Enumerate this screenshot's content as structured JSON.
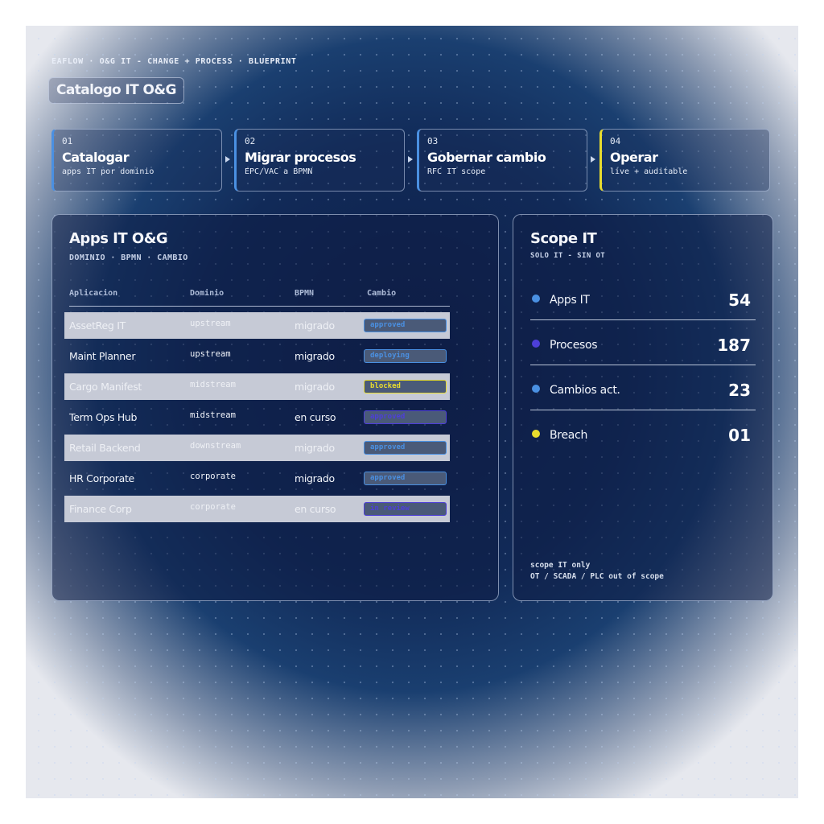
{
  "header": {
    "topline": "EAFLOW · O&G IT - CHANGE + PROCESS · BLUEPRINT",
    "title": "Catalogo IT O&G"
  },
  "steps": [
    {
      "num": "01",
      "label": "Catalogar",
      "sub": "apps IT por dominio"
    },
    {
      "num": "02",
      "label": "Migrar procesos",
      "sub": "EPC/VAC a BPMN"
    },
    {
      "num": "03",
      "label": "Gobernar cambio",
      "sub": "RFC IT scope"
    },
    {
      "num": "04",
      "label": "Operar",
      "sub": "live + auditable"
    }
  ],
  "apps": {
    "title": "Apps IT O&G",
    "subtitle": "DOMINIO · BPMN · CAMBIO",
    "columns": [
      "Aplicacion",
      "Dominio",
      "BPMN",
      "Cambio"
    ],
    "rows": [
      {
        "app": "AssetReg IT",
        "dominio": "upstream",
        "bpmn": "migrado",
        "cambio": "approved"
      },
      {
        "app": "Maint Planner",
        "dominio": "upstream",
        "bpmn": "migrado",
        "cambio": "deploying"
      },
      {
        "app": "Cargo Manifest",
        "dominio": "midstream",
        "bpmn": "migrado",
        "cambio": "blocked"
      },
      {
        "app": "Term Ops Hub",
        "dominio": "midstream",
        "bpmn": "en curso",
        "cambio": "approved"
      },
      {
        "app": "Retail Backend",
        "dominio": "downstream",
        "bpmn": "migrado",
        "cambio": "approved"
      },
      {
        "app": "HR Corporate",
        "dominio": "corporate",
        "bpmn": "migrado",
        "cambio": "approved"
      },
      {
        "app": "Finance Corp",
        "dominio": "corporate",
        "bpmn": "en curso",
        "cambio": "in review"
      }
    ]
  },
  "scope": {
    "title": "Scope IT",
    "subtitle": "SOLO IT - SIN OT",
    "stats": [
      {
        "name": "Apps IT",
        "value": "54",
        "color": "#4a90e2"
      },
      {
        "name": "Procesos",
        "value": "187",
        "color": "#4d3fd8"
      },
      {
        "name": "Cambios act.",
        "value": "23",
        "color": "#4a90e2"
      },
      {
        "name": "Breach",
        "value": "01",
        "color": "#e8dc2e"
      }
    ],
    "footer_line1": "scope IT only",
    "footer_line2": "OT / SCADA / PLC out of scope"
  },
  "colors": {
    "accent_blue": "#4a90e2",
    "accent_purple": "#4d3fd8",
    "accent_yellow": "#e8dc2e",
    "navy": "#0f1f48"
  }
}
